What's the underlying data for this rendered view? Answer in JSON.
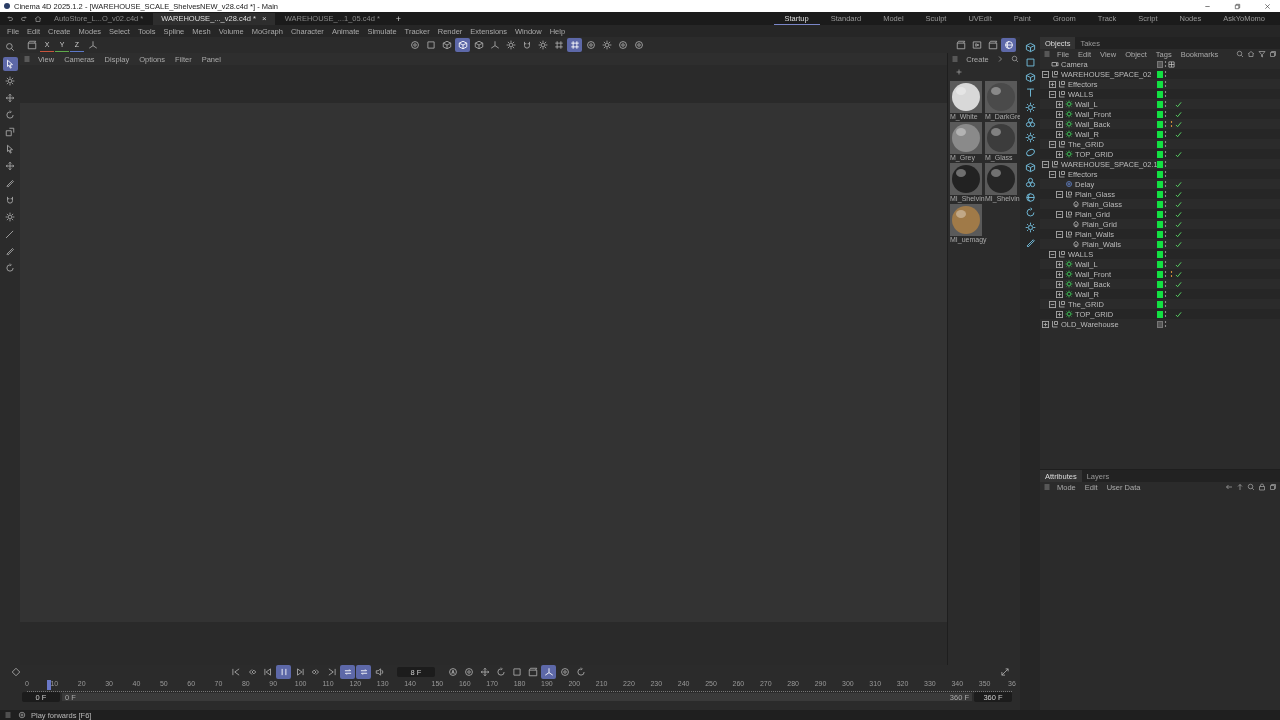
{
  "window": {
    "title": "Cinema 4D 2025.1.2 - [WAREHOUSE_SCALE_ShelvesNEW_v28.c4d *] - Main"
  },
  "file_tabs": [
    {
      "label": "AutoStore_L...O_v02.c4d *",
      "selected": false
    },
    {
      "label": "WAREHOUSE_..._v28.c4d *",
      "selected": true,
      "close": "×"
    },
    {
      "label": "WAREHOUSE_...1_05.c4d *",
      "selected": false
    }
  ],
  "new_tab": "+",
  "layouts": [
    {
      "label": "Startup",
      "selected": true
    },
    {
      "label": "Standard",
      "selected": false
    },
    {
      "label": "Model",
      "selected": false
    },
    {
      "label": "Sculpt",
      "selected": false
    },
    {
      "label": "UVEdit",
      "selected": false
    },
    {
      "label": "Paint",
      "selected": false
    },
    {
      "label": "Groom",
      "selected": false
    },
    {
      "label": "Track",
      "selected": false
    },
    {
      "label": "Script",
      "selected": false
    },
    {
      "label": "Nodes",
      "selected": false
    },
    {
      "label": "AskYoMomo",
      "selected": false
    }
  ],
  "menu": [
    "File",
    "Edit",
    "Create",
    "Modes",
    "Select",
    "Tools",
    "Spline",
    "Mesh",
    "Volume",
    "MoGraph",
    "Character",
    "Animate",
    "Simulate",
    "Tracker",
    "Render",
    "Extensions",
    "Window",
    "Help"
  ],
  "toolbar": {
    "axes": [
      "X",
      "Y",
      "Z"
    ],
    "tools": [
      {
        "kind": "circle",
        "selected": false
      },
      {
        "kind": "square",
        "selected": false
      },
      {
        "kind": "cube",
        "selected": false
      },
      {
        "kind": "cube",
        "selected": true
      },
      {
        "kind": "cube",
        "selected": false
      },
      {
        "kind": "axis",
        "selected": false
      },
      {
        "kind": "gear",
        "selected": false
      },
      {
        "kind": "magnet",
        "selected": false
      },
      {
        "kind": "gear",
        "selected": false
      },
      {
        "kind": "grid",
        "selected": false
      },
      {
        "kind": "grid",
        "selected": true
      },
      {
        "kind": "circle",
        "selected": false
      },
      {
        "kind": "gear",
        "selected": false
      },
      {
        "kind": "circle",
        "selected": false
      },
      {
        "kind": "circle",
        "selected": false
      }
    ],
    "render_tools": [
      {
        "kind": "film",
        "selected": false
      },
      {
        "kind": "play",
        "selected": false
      },
      {
        "kind": "film",
        "selected": false
      },
      {
        "kind": "sphere",
        "selected": true
      }
    ]
  },
  "left_tools": [
    {
      "kind": "search",
      "selected": false
    },
    {
      "kind": "cursor",
      "selected": true
    },
    {
      "kind": "gear",
      "selected": false
    },
    {
      "kind": "move",
      "selected": false
    },
    {
      "kind": "rotate",
      "selected": false
    },
    {
      "kind": "scale",
      "selected": false
    },
    {
      "kind": "cursor",
      "selected": false
    },
    {
      "kind": "move",
      "selected": false
    },
    {
      "kind": "pen",
      "selected": false
    },
    {
      "kind": "magnet",
      "selected": false
    },
    {
      "kind": "gear",
      "selected": false
    },
    {
      "kind": "brush",
      "selected": false
    },
    {
      "kind": "pen",
      "selected": false
    },
    {
      "kind": "rotate",
      "selected": false
    }
  ],
  "viewport": {
    "menu": [
      "View",
      "Cameras",
      "Display",
      "Options",
      "Filter",
      "Panel"
    ]
  },
  "materials": {
    "menu": "Create",
    "items": [
      {
        "name": "M_White",
        "color": "#d8d8d8"
      },
      {
        "name": "M_DarkGre",
        "color": "#4a4a4a"
      },
      {
        "name": "M_Grey",
        "color": "#8a8a8a"
      },
      {
        "name": "M_Glass",
        "color": "#3c3c3c"
      },
      {
        "name": "MI_Shelvin",
        "color": "#222222"
      },
      {
        "name": "MI_Shelvin",
        "color": "#262626"
      },
      {
        "name": "MI_uemagy",
        "color": "#a07a48"
      }
    ]
  },
  "right_tools": [
    {
      "kind": "cube"
    },
    {
      "kind": "square"
    },
    {
      "kind": "cube"
    },
    {
      "kind": "text"
    },
    {
      "kind": "gear"
    },
    {
      "kind": "cluster"
    },
    {
      "kind": "gear"
    },
    {
      "kind": "ring"
    },
    {
      "kind": "cube"
    },
    {
      "kind": "cluster"
    },
    {
      "kind": "sphere"
    },
    {
      "kind": "rotate"
    },
    {
      "kind": "gear"
    },
    {
      "kind": "pen"
    }
  ],
  "objects": {
    "tabs": [
      {
        "label": "Objects",
        "selected": true
      },
      {
        "label": "Takes",
        "selected": false
      }
    ],
    "menu": [
      "File",
      "Edit",
      "View",
      "Object",
      "Tags",
      "Bookmarks"
    ],
    "tree": [
      {
        "name": "Camera",
        "kind": "camera",
        "visible": false,
        "checked": false,
        "tag": {
          "kind": "target"
        }
      },
      {
        "name": "WAREHOUSE_SPACE_02",
        "kind": "null",
        "visible": true,
        "checked": false,
        "expanded": true,
        "children": [
          {
            "name": "Effectors",
            "kind": "null",
            "visible": true,
            "checked": false,
            "expanded": false
          },
          {
            "name": "WALLS",
            "kind": "null",
            "visible": true,
            "checked": false,
            "expanded": true,
            "children": [
              {
                "name": "Wall_L",
                "kind": "cloner",
                "visible": true,
                "checked": true,
                "expanded": false
              },
              {
                "name": "Wall_Front",
                "kind": "cloner",
                "visible": true,
                "checked": true,
                "expanded": false
              },
              {
                "name": "Wall_Back",
                "kind": "cloner",
                "visible": true,
                "checked": true,
                "expanded": false,
                "tag": {
                  "kind": "dots"
                }
              },
              {
                "name": "Wall_R",
                "kind": "cloner",
                "visible": true,
                "checked": true,
                "expanded": false
              }
            ]
          },
          {
            "name": "The_GRID",
            "kind": "null",
            "visible": true,
            "checked": false,
            "expanded": true,
            "children": [
              {
                "name": "TOP_GRID",
                "kind": "cloner",
                "visible": true,
                "checked": true,
                "expanded": false
              }
            ]
          }
        ]
      },
      {
        "name": "WAREHOUSE_SPACE_02.1",
        "kind": "null",
        "visible": true,
        "checked": false,
        "expanded": true,
        "children": [
          {
            "name": "Effectors",
            "kind": "null",
            "visible": true,
            "checked": false,
            "expanded": true,
            "children": [
              {
                "name": "Delay",
                "kind": "effector",
                "visible": true,
                "checked": true
              },
              {
                "name": "Plain_Glass",
                "kind": "group",
                "visible": true,
                "checked": true,
                "expanded": true,
                "children": [
                  {
                    "name": "Plain_Glass",
                    "kind": "plain",
                    "visible": true,
                    "checked": true
                  }
                ]
              },
              {
                "name": "Plain_Grid",
                "kind": "group",
                "visible": true,
                "checked": true,
                "expanded": true,
                "children": [
                  {
                    "name": "Plain_Grid",
                    "kind": "plain",
                    "visible": true,
                    "checked": true
                  }
                ]
              },
              {
                "name": "Plain_Walls",
                "kind": "group",
                "visible": true,
                "checked": true,
                "expanded": true,
                "children": [
                  {
                    "name": "Plain_Walls",
                    "kind": "plain",
                    "visible": true,
                    "checked": true
                  }
                ]
              }
            ]
          },
          {
            "name": "WALLS",
            "kind": "null",
            "visible": true,
            "checked": false,
            "expanded": true,
            "children": [
              {
                "name": "Wall_L",
                "kind": "cloner",
                "visible": true,
                "checked": true,
                "expanded": false
              },
              {
                "name": "Wall_Front",
                "kind": "cloner",
                "visible": true,
                "checked": true,
                "expanded": false,
                "tag": {
                  "kind": "dots"
                }
              },
              {
                "name": "Wall_Back",
                "kind": "cloner",
                "visible": true,
                "checked": true,
                "expanded": false
              },
              {
                "name": "Wall_R",
                "kind": "cloner",
                "visible": true,
                "checked": true,
                "expanded": false
              }
            ]
          },
          {
            "name": "The_GRID",
            "kind": "null",
            "visible": true,
            "checked": false,
            "expanded": true,
            "children": [
              {
                "name": "TOP_GRID",
                "kind": "cloner",
                "visible": true,
                "checked": true,
                "expanded": false
              }
            ]
          }
        ]
      },
      {
        "name": "OLD_Warehouse",
        "kind": "null",
        "visible": false,
        "checked": false,
        "expanded": false
      }
    ]
  },
  "attributes": {
    "tabs": [
      {
        "label": "Attributes",
        "selected": true
      },
      {
        "label": "Layers",
        "selected": false
      }
    ],
    "menu": [
      "Mode",
      "Edit",
      "User Data"
    ]
  },
  "timeline": {
    "controls": [
      {
        "kind": "skip-start",
        "selected": false
      },
      {
        "kind": "prev-key",
        "selected": false
      },
      {
        "kind": "prev-frame",
        "selected": false
      },
      {
        "kind": "pause",
        "selected": true
      },
      {
        "kind": "next-frame",
        "selected": false
      },
      {
        "kind": "next-key",
        "selected": false
      },
      {
        "kind": "skip-end",
        "selected": false
      },
      {
        "kind": "loop",
        "selected": true
      },
      {
        "kind": "loop",
        "selected": true
      },
      {
        "kind": "sound",
        "selected": false
      }
    ],
    "current_frame": "8 F",
    "key_tools": [
      {
        "kind": "record",
        "selected": false
      },
      {
        "kind": "circle",
        "selected": false
      },
      {
        "kind": "move",
        "selected": false
      },
      {
        "kind": "rotate",
        "selected": false
      },
      {
        "kind": "square",
        "selected": false
      },
      {
        "kind": "film",
        "selected": false
      },
      {
        "kind": "axis",
        "selected": true
      },
      {
        "kind": "circle",
        "selected": false
      },
      {
        "kind": "rotate",
        "selected": false
      }
    ],
    "ruler": [
      "0",
      "10",
      "20",
      "30",
      "40",
      "50",
      "60",
      "70",
      "80",
      "90",
      "100",
      "110",
      "120",
      "130",
      "140",
      "150",
      "160",
      "170",
      "180",
      "190",
      "200",
      "210",
      "220",
      "230",
      "240",
      "250",
      "260",
      "270",
      "280",
      "290",
      "300",
      "310",
      "320",
      "330",
      "340",
      "350",
      "36"
    ],
    "playhead": {
      "level": 0.022
    },
    "start": "0 F",
    "preview_start": "0 F",
    "preview_end": "360 F",
    "end": "360 F"
  },
  "status": "Play forwards [F6]"
}
